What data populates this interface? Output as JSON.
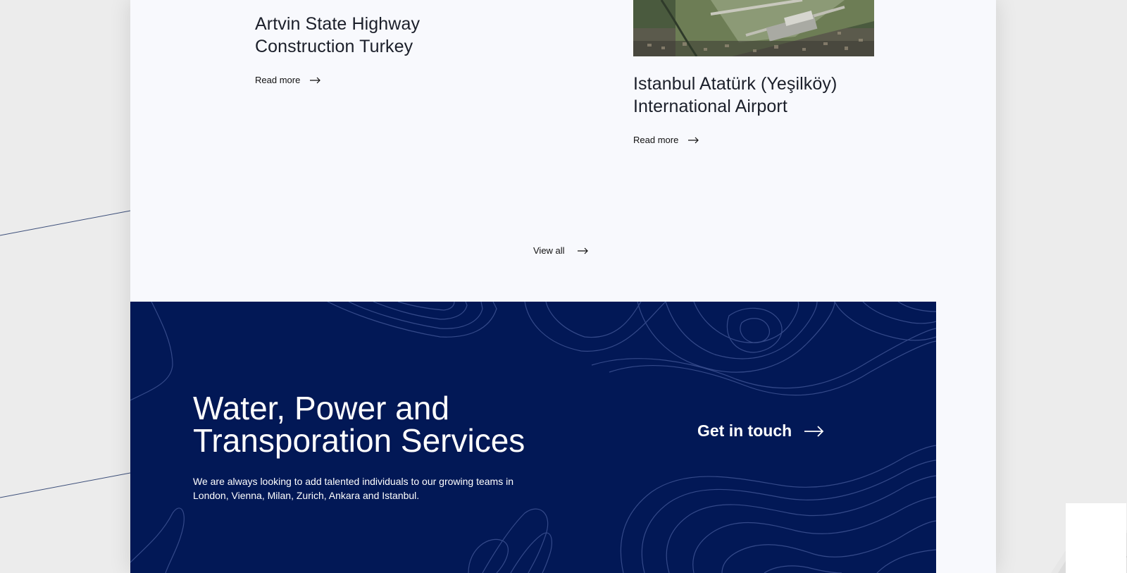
{
  "projects": [
    {
      "title_line1": "Artvin State Highway",
      "title_line2": "Construction Turkey",
      "link_label": "Read more",
      "icon": "arrow-right-icon"
    },
    {
      "title_line1": "Istanbul Atatürk (Yeşilköy)",
      "title_line2": "International Airport",
      "link_label": "Read more",
      "icon": "arrow-right-icon"
    }
  ],
  "view_all_label": "View all",
  "cta": {
    "title_line1": "Water, Power and",
    "title_line2": "Transporation Services",
    "text_line1": "We are always looking to add talented individuals to our growing teams in",
    "text_line2": "London, Vienna, Milan, Zurich, Ankara and Istanbul.",
    "button_label": "Get in touch",
    "icon": "arrow-right-icon"
  },
  "colors": {
    "page_background": "#f8f9fd",
    "outer_background": "#ececec",
    "cta_background": "#021856",
    "topo_lines": "#3a4f8f",
    "text_dark": "#1b1f2a"
  }
}
